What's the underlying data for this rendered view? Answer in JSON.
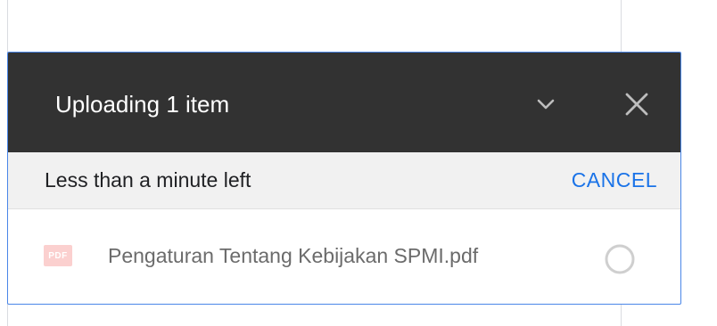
{
  "upload_panel": {
    "title": "Uploading 1 item",
    "collapse_icon": "chevron-down-icon",
    "close_icon": "close-icon",
    "status_text": "Less than a minute left",
    "cancel_label": "CANCEL",
    "files": [
      {
        "name": "Pengaturan Tentang Kebijakan SPMI.pdf",
        "type_label": "PDF",
        "type_icon": "pdf-file-icon",
        "status_icon": "progress-circle-icon"
      }
    ]
  },
  "colors": {
    "header_bg": "#323232",
    "accent": "#1a73e8",
    "status_bg": "#f1f1f1",
    "pdf_icon_bg": "#fbd0cf"
  }
}
